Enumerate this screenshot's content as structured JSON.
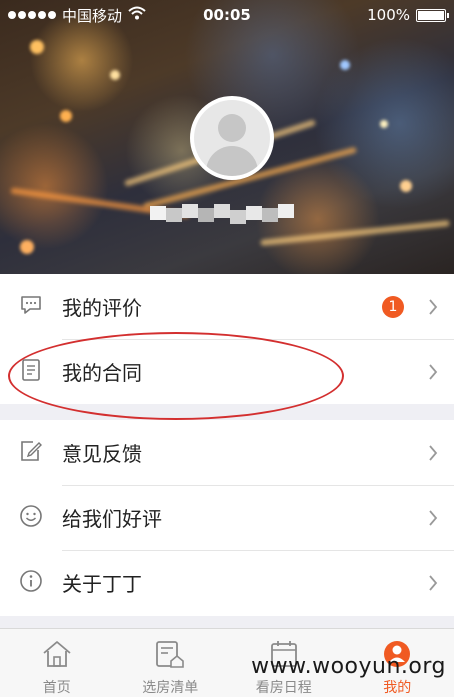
{
  "status_bar": {
    "carrier": "中国移动",
    "time": "00:05",
    "battery": "100%"
  },
  "profile": {
    "username_masked": ""
  },
  "menu_section_1": [
    {
      "label": "我的评价",
      "icon": "comment-icon",
      "badge": "1"
    },
    {
      "label": "我的合同",
      "icon": "document-icon",
      "badge": ""
    }
  ],
  "menu_section_2": [
    {
      "label": "意见反馈",
      "icon": "edit-icon"
    },
    {
      "label": "给我们好评",
      "icon": "smile-icon"
    },
    {
      "label": "关于丁丁",
      "icon": "info-icon"
    }
  ],
  "tabbar": {
    "tabs": [
      {
        "label": "首页",
        "icon": "home-icon",
        "active": false
      },
      {
        "label": "选房清单",
        "icon": "house-list-icon",
        "active": false
      },
      {
        "label": "看房日程",
        "icon": "calendar-icon",
        "active": false
      },
      {
        "label": "我的",
        "icon": "profile-icon",
        "active": true
      }
    ]
  },
  "watermark": "www.wooyun.org",
  "colors": {
    "accent": "#f05a22",
    "annotation": "#d32f2f"
  }
}
